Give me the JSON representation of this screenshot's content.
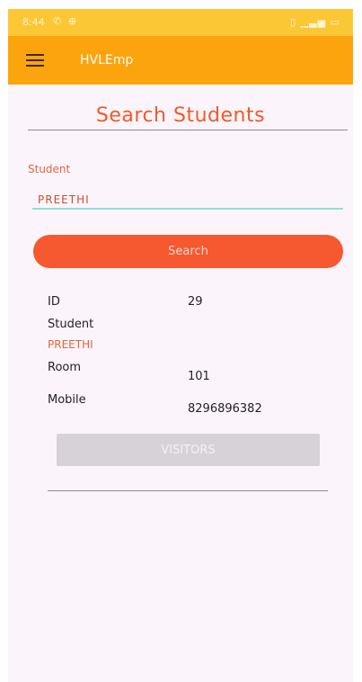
{
  "status_bar": {
    "time": "8:44",
    "icons": [
      "phone-icon",
      "location-icon",
      "vibrate-icon",
      "signal-icon",
      "battery-icon"
    ]
  },
  "app_bar": {
    "title": "HVLEmp"
  },
  "page": {
    "title": "Search Students"
  },
  "search_form": {
    "student_label": "Student",
    "student_value": "PREETHI",
    "search_label": "Search"
  },
  "details": {
    "id_label": "ID",
    "id_value": "29",
    "student_label": "Student",
    "student_name": "PREETHI",
    "room_label": "Room",
    "room_value": "101",
    "mobile_label": "Mobile",
    "mobile_value": "8296896382"
  },
  "actions": {
    "visitors_label": "VISITORS"
  },
  "colors": {
    "status_bar": "#fcc735",
    "app_bar": "#fca40e",
    "accent": "#f6582f",
    "title": "#f05a28",
    "input_underline": "#8fe0d6",
    "disabled_button": "#d7d2d7",
    "background": "#fcf4fb"
  }
}
